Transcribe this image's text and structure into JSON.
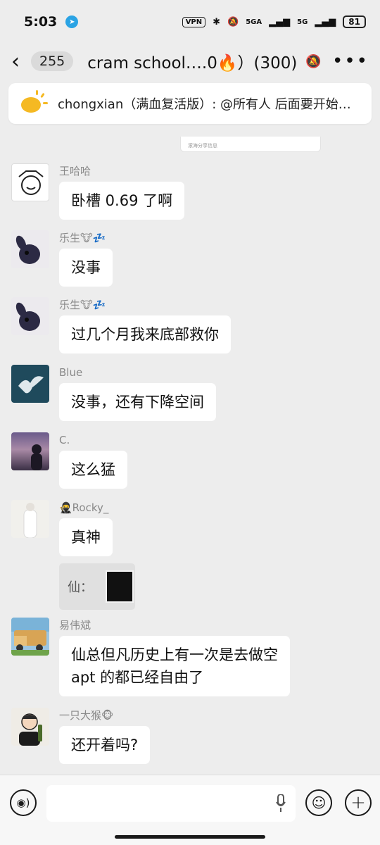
{
  "status_bar": {
    "time": "5:03",
    "vpn": "VPN",
    "network_1": "5GA",
    "network_2": "5G",
    "battery": "81"
  },
  "header": {
    "unread_count": "255",
    "title": "cram school….0🔥）(300)"
  },
  "notice": {
    "text": "chongxian（满血复活版）: @所有人 后面要开始…"
  },
  "quoted_card_caption": "滚海分享信息",
  "messages": [
    {
      "sender": "王哈哈",
      "text": "卧槽 0.69 了啊"
    },
    {
      "sender": "乐生🐮💤",
      "text": "没事"
    },
    {
      "sender": "乐生🐮💤",
      "text": "过几个月我来底部救你"
    },
    {
      "sender": "Blue",
      "text": "没事，还有下降空间"
    },
    {
      "sender": "C.",
      "text": "这么猛"
    },
    {
      "sender": "🥷Rocky_",
      "text": "真神",
      "reply_label": "仙："
    },
    {
      "sender": "易伟斌",
      "text_line1": "仙总但凡历史上有一次是去做空",
      "text_line2": "apt 的都已经自由了"
    },
    {
      "sender": "一只大猴🐵",
      "text": "还开着吗?"
    }
  ],
  "colors": {
    "background": "#ededed",
    "bubble": "#ffffff",
    "notice_icon": "#f5b923"
  },
  "icons": [
    "back-icon",
    "mute-icon",
    "more-icon",
    "megaphone-icon",
    "voice-icon",
    "mic-icon",
    "emoji-icon",
    "plus-icon"
  ]
}
